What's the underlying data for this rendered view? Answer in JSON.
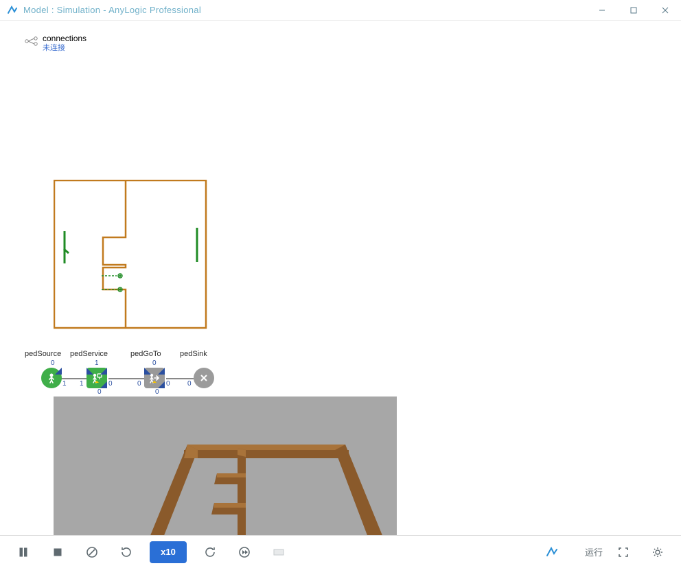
{
  "window": {
    "title": "Model : Simulation - AnyLogic Professional"
  },
  "connections": {
    "label": "connections",
    "status": "未连接"
  },
  "flow": {
    "pedSource": {
      "label": "pedSource",
      "topPort": "0",
      "outPort": "1"
    },
    "pedService": {
      "label": "pedService",
      "topPort": "1",
      "inPort": "1",
      "outPort": "0",
      "bottomPort": "0"
    },
    "pedGoTo": {
      "label": "pedGoTo",
      "topPort": "0",
      "inPort": "0",
      "outPort": "0",
      "bottomPort": "0"
    },
    "pedSink": {
      "label": "pedSink",
      "inPort": "0"
    }
  },
  "toolbar": {
    "speed": "x10",
    "status": "运行"
  },
  "colors": {
    "wall2d": "#c17a1e",
    "green": "#1f8b24",
    "wall3d": "#8a5a2b",
    "wall3dTop": "#a8733a",
    "accent": "#2a6fd6"
  }
}
